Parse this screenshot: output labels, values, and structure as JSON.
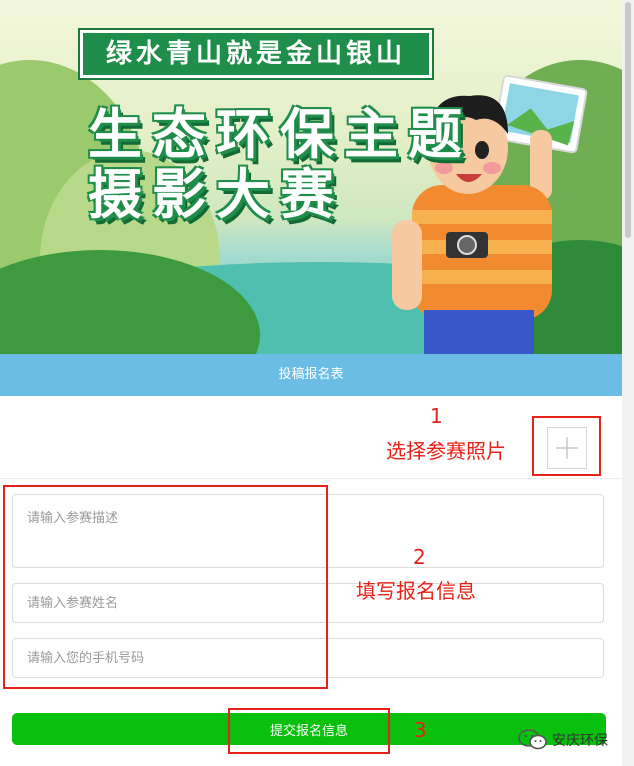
{
  "banner": {
    "slogan": "绿水青山就是金山银山",
    "title_line1": "生态环保主题",
    "title_line2": "摄影大赛"
  },
  "form": {
    "header": "投稿报名表",
    "upload_icon": "plus-icon",
    "description_placeholder": "请输入参赛描述",
    "name_placeholder": "请输入参赛姓名",
    "phone_placeholder": "请输入您的手机号码",
    "submit_label": "提交报名信息"
  },
  "annotations": {
    "step1_number": "1",
    "step1_text": "选择参赛照片",
    "step2_number": "2",
    "step2_text": "填写报名信息",
    "step3_number": "3"
  },
  "watermark": {
    "text": "安庆环保",
    "icon": "wechat-icon"
  },
  "colors": {
    "header_bg": "#6cbde6",
    "submit_bg": "#09c00e",
    "annotation": "#e62117",
    "slogan_bg": "#1f8e4a"
  }
}
